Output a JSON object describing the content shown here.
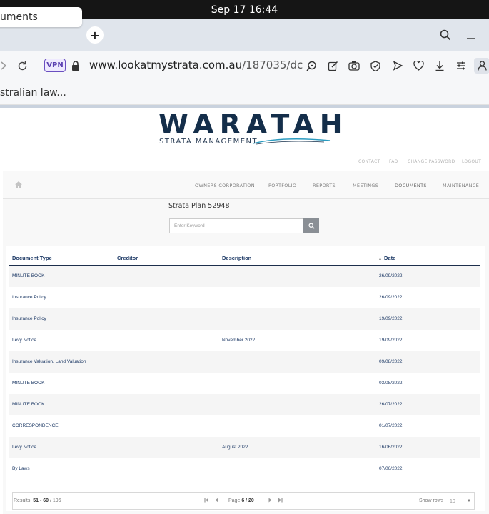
{
  "system": {
    "datetime": "Sep 17  16:44"
  },
  "browser": {
    "tab_title": "uments",
    "vpn_label": "VPN",
    "url_domain": "www.lookatmystrata.com.au",
    "url_path": "/187035/dc",
    "bookmark": "stralian law..."
  },
  "site": {
    "logo_word": "WARATAH",
    "logo_sub": "STRATA MANAGEMENT",
    "util_links": [
      "CONTACT",
      "FAQ",
      "CHANGE PASSWORD",
      "LOGOUT"
    ],
    "nav": [
      "OWNERS CORPORATION",
      "PORTFOLIO",
      "REPORTS",
      "MEETINGS",
      "DOCUMENTS",
      "MAINTENANCE"
    ],
    "active_nav": "DOCUMENTS"
  },
  "main": {
    "plan_title": "Strata Plan 52948",
    "search_placeholder": "Enter Keyword"
  },
  "table": {
    "headers": [
      "Document Type",
      "Creditor",
      "Description",
      "Date"
    ],
    "rows": [
      {
        "type": "MINUTE BOOK",
        "creditor": "",
        "description": "",
        "date": "26/09/2022"
      },
      {
        "type": "Insurance Policy",
        "creditor": "",
        "description": "",
        "date": "26/09/2022"
      },
      {
        "type": "Insurance Policy",
        "creditor": "",
        "description": "",
        "date": "19/09/2022"
      },
      {
        "type": "Levy Notice",
        "creditor": "",
        "description": "November 2022",
        "date": "19/09/2022"
      },
      {
        "type": "Insurance Valuation, Land Valuation",
        "creditor": "",
        "description": "",
        "date": "09/08/2022"
      },
      {
        "type": "MINUTE BOOK",
        "creditor": "",
        "description": "",
        "date": "03/08/2022"
      },
      {
        "type": "MINUTE BOOK",
        "creditor": "",
        "description": "",
        "date": "26/07/2022"
      },
      {
        "type": "CORRESPONDENCE",
        "creditor": "",
        "description": "",
        "date": "01/07/2022"
      },
      {
        "type": "Levy Notice",
        "creditor": "",
        "description": "August 2022",
        "date": "16/06/2022"
      },
      {
        "type": "By Laws",
        "creditor": "",
        "description": "",
        "date": "07/06/2022"
      }
    ]
  },
  "pager": {
    "results_label": "Results:",
    "results_range": "51 - 60",
    "results_total": "/ 196",
    "page_label": "Page",
    "page_value": "6 / 20",
    "show_rows_label": "Show rows",
    "rows_value": "10"
  },
  "colors": {
    "brand_navy": "#142e4a",
    "link_blue": "#1e3a66"
  }
}
